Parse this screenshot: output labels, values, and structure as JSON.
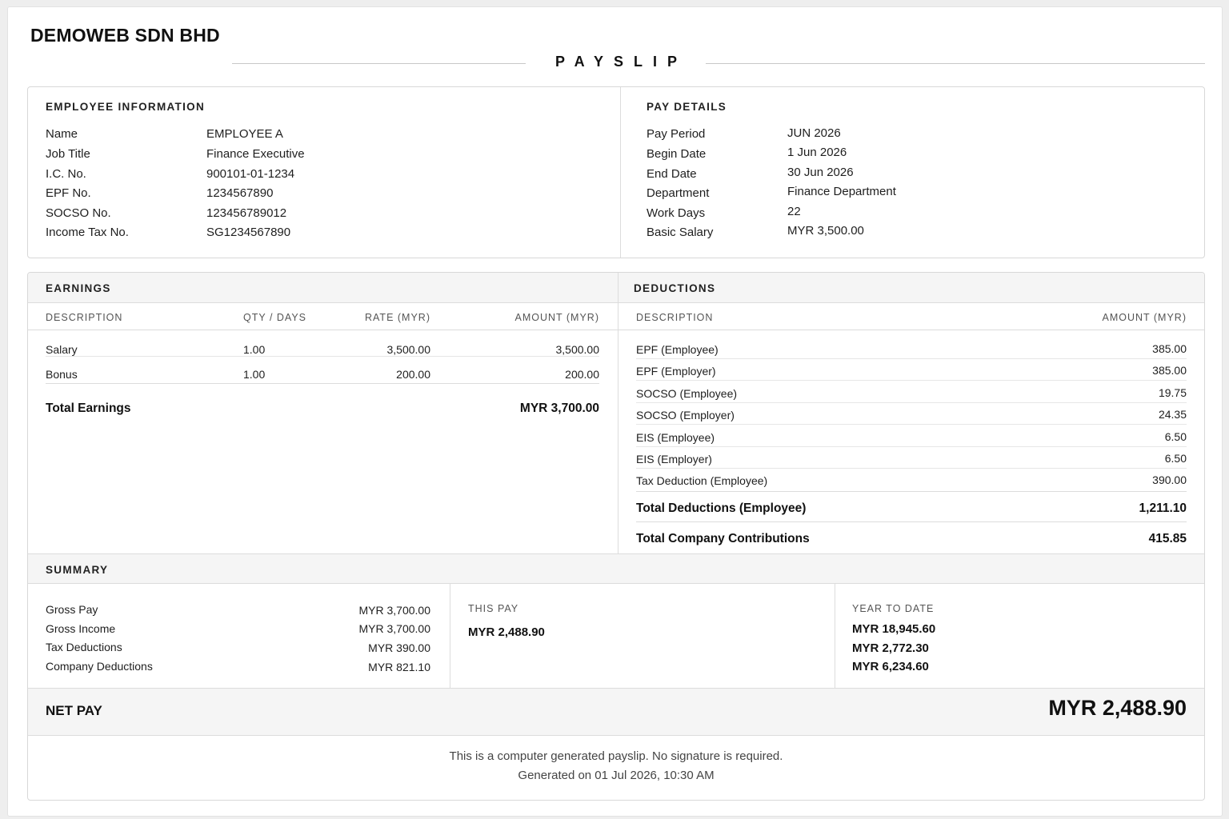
{
  "company": "DEMOWEB SDN BHD",
  "title": "PAYSLIP",
  "employee": {
    "heading": "EMPLOYEE INFORMATION",
    "rows": [
      {
        "label": "Name",
        "value": "EMPLOYEE A"
      },
      {
        "label": "Job Title",
        "value": "Finance Executive"
      },
      {
        "label": "I.C. No.",
        "value": "900101-01-1234"
      },
      {
        "label": "EPF No.",
        "value": "1234567890"
      },
      {
        "label": "SOCSO No.",
        "value": "123456789012"
      },
      {
        "label": "Income Tax No.",
        "value": "SG1234567890"
      }
    ]
  },
  "pay_details": {
    "heading": "PAY DETAILS",
    "rows": [
      {
        "label": "Pay Period",
        "value": "JUN 2026"
      },
      {
        "label": "Begin Date",
        "value": "1 Jun 2026"
      },
      {
        "label": "End Date",
        "value": "30 Jun 2026"
      },
      {
        "label": "Department",
        "value": "Finance Department"
      },
      {
        "label": "Work Days",
        "value": "22"
      },
      {
        "label": "Basic Salary",
        "value": "MYR 3,500.00"
      }
    ]
  },
  "earnings": {
    "heading": "EARNINGS",
    "columns": [
      "DESCRIPTION",
      "QTY / DAYS",
      "RATE (MYR)",
      "AMOUNT (MYR)"
    ],
    "rows": [
      {
        "description": "Salary",
        "qty": "1.00",
        "rate": "3,500.00",
        "amount": "3,500.00"
      },
      {
        "description": "Bonus",
        "qty": "1.00",
        "rate": "200.00",
        "amount": "200.00"
      }
    ],
    "total_label": "Total Earnings",
    "total_value": "MYR 3,700.00"
  },
  "deductions": {
    "heading": "DEDUCTIONS",
    "columns": [
      "DESCRIPTION",
      "AMOUNT (MYR)"
    ],
    "rows": [
      {
        "description": "EPF (Employee)",
        "amount": "385.00"
      },
      {
        "description": "EPF (Employer)",
        "amount": "385.00"
      },
      {
        "description": "SOCSO (Employee)",
        "amount": "19.75"
      },
      {
        "description": "SOCSO (Employer)",
        "amount": "24.35"
      },
      {
        "description": "EIS (Employee)",
        "amount": "6.50"
      },
      {
        "description": "EIS (Employer)",
        "amount": "6.50"
      },
      {
        "description": "Tax Deduction (Employee)",
        "amount": "390.00"
      }
    ],
    "total_employee_label": "Total Deductions (Employee)",
    "total_employee_value": "1,211.10",
    "total_company_label": "Total Company Contributions",
    "total_company_value": "415.85"
  },
  "summary": {
    "heading": "SUMMARY",
    "rows": [
      {
        "label": "Gross Pay",
        "value": "MYR 3,700.00"
      },
      {
        "label": "Gross Income",
        "value": "MYR 3,700.00"
      },
      {
        "label": "Tax Deductions",
        "value": "MYR 390.00"
      },
      {
        "label": "Company Deductions",
        "value": "MYR 821.10"
      }
    ],
    "this_pay_label": "THIS PAY",
    "this_pay_value": "MYR 2,488.90",
    "ytd_label": "YEAR TO DATE",
    "ytd_values": [
      "MYR 18,945.60",
      "MYR 2,772.30",
      "MYR 6,234.60"
    ]
  },
  "net_pay": {
    "label": "NET PAY",
    "value": "MYR 2,488.90"
  },
  "footer": {
    "line1": "This is a computer generated payslip. No signature is required.",
    "line2": "Generated on 01 Jul 2026, 10:30 AM"
  }
}
